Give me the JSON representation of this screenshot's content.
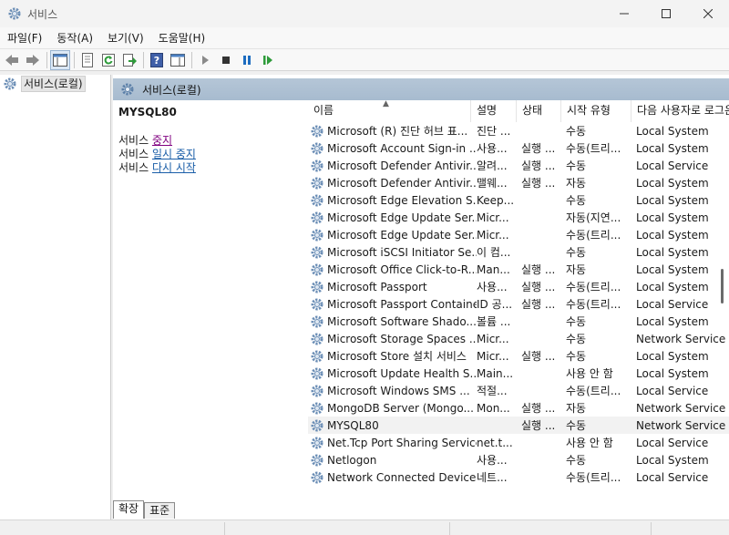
{
  "window": {
    "title": "서비스"
  },
  "menu": [
    "파일(F)",
    "동작(A)",
    "보기(V)",
    "도움말(H)"
  ],
  "tree": {
    "root": "서비스(로컬)"
  },
  "pane": {
    "header": "서비스(로컬)"
  },
  "detail": {
    "service_name": "MYSQL80",
    "actions": [
      {
        "prefix": "서비스 ",
        "link": "중지"
      },
      {
        "prefix": "서비스 ",
        "link": "일시 중지"
      },
      {
        "prefix": "서비스 ",
        "link": "다시 시작"
      }
    ]
  },
  "columns": [
    "이름",
    "설명",
    "상태",
    "시작 유형",
    "다음 사용자로 로그온"
  ],
  "rows": [
    {
      "name": "Microsoft (R) 진단 허브 표...",
      "desc": "진단 ...",
      "state": "",
      "type": "수동",
      "logon": "Local System"
    },
    {
      "name": "Microsoft Account Sign-in ...",
      "desc": "사용...",
      "state": "실행 ...",
      "type": "수동(트리...",
      "logon": "Local System"
    },
    {
      "name": "Microsoft Defender Antivir...",
      "desc": "알려...",
      "state": "실행 ...",
      "type": "수동",
      "logon": "Local Service"
    },
    {
      "name": "Microsoft Defender Antivir...",
      "desc": "맬웨...",
      "state": "실행 ...",
      "type": "자동",
      "logon": "Local System"
    },
    {
      "name": "Microsoft Edge Elevation S...",
      "desc": "Keep...",
      "state": "",
      "type": "수동",
      "logon": "Local System"
    },
    {
      "name": "Microsoft Edge Update Ser...",
      "desc": "Micr...",
      "state": "",
      "type": "자동(지연...",
      "logon": "Local System"
    },
    {
      "name": "Microsoft Edge Update Ser...",
      "desc": "Micr...",
      "state": "",
      "type": "수동(트리...",
      "logon": "Local System"
    },
    {
      "name": "Microsoft iSCSI Initiator Se...",
      "desc": "이 컴...",
      "state": "",
      "type": "수동",
      "logon": "Local System"
    },
    {
      "name": "Microsoft Office Click-to-R...",
      "desc": "Man...",
      "state": "실행 ...",
      "type": "자동",
      "logon": "Local System"
    },
    {
      "name": "Microsoft Passport",
      "desc": "사용...",
      "state": "실행 ...",
      "type": "수동(트리...",
      "logon": "Local System"
    },
    {
      "name": "Microsoft Passport Container",
      "desc": "ID 공...",
      "state": "실행 ...",
      "type": "수동(트리...",
      "logon": "Local Service"
    },
    {
      "name": "Microsoft Software Shado...",
      "desc": "볼륨 ...",
      "state": "",
      "type": "수동",
      "logon": "Local System"
    },
    {
      "name": "Microsoft Storage Spaces ...",
      "desc": "Micr...",
      "state": "",
      "type": "수동",
      "logon": "Network Service"
    },
    {
      "name": "Microsoft Store 설치 서비스",
      "desc": "Micr...",
      "state": "실행 ...",
      "type": "수동",
      "logon": "Local System"
    },
    {
      "name": "Microsoft Update Health S...",
      "desc": "Main...",
      "state": "",
      "type": "사용 안 함",
      "logon": "Local System"
    },
    {
      "name": "Microsoft Windows SMS ...",
      "desc": "적절...",
      "state": "",
      "type": "수동(트리...",
      "logon": "Local Service"
    },
    {
      "name": "MongoDB Server (Mongo...",
      "desc": "Mon...",
      "state": "실행 ...",
      "type": "자동",
      "logon": "Network Service"
    },
    {
      "name": "MYSQL80",
      "desc": "",
      "state": "실행 ...",
      "type": "수동",
      "logon": "Network Service"
    },
    {
      "name": "Net.Tcp Port Sharing Service",
      "desc": "net.t...",
      "state": "",
      "type": "사용 안 함",
      "logon": "Local Service"
    },
    {
      "name": "Netlogon",
      "desc": "사용...",
      "state": "",
      "type": "수동",
      "logon": "Local System"
    },
    {
      "name": "Network Connected Device...",
      "desc": "네트...",
      "state": "",
      "type": "수동(트리...",
      "logon": "Local Service"
    }
  ],
  "selected_row": "MYSQL80",
  "tabs": [
    "확장",
    "표준"
  ],
  "colors": {
    "pane_header": "#afc1d3",
    "link": "#1a5ea8",
    "link_visited": "#800080"
  }
}
